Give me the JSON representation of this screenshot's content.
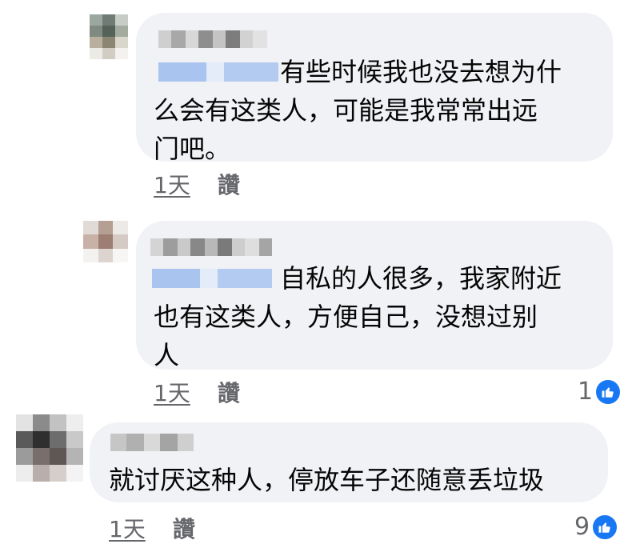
{
  "comments": [
    {
      "text_line1": "有些时候我也没去想为什",
      "text_line2": "么会有这类人，可能是我常常出远",
      "text_line3": "门吧。",
      "time": "1天",
      "like_label": "讚"
    },
    {
      "text_line1": "自私的人很多，我家附近",
      "text_line2": "也有这类人，方便自己，没想过别",
      "text_line3": "人",
      "time": "1天",
      "like_label": "讚",
      "reaction_count": "1"
    },
    {
      "text_line1": "就讨厌这种人，停放车子还随意丢垃圾",
      "time": "1天",
      "like_label": "讚",
      "reaction_count": "9"
    }
  ],
  "colors": {
    "bubble": "#f0f2f5",
    "meta_text": "#65676b",
    "like_badge": "#1877f2",
    "mention_blur": "#a9c4ef"
  },
  "icons": {
    "reaction": "thumbs-up-icon"
  }
}
